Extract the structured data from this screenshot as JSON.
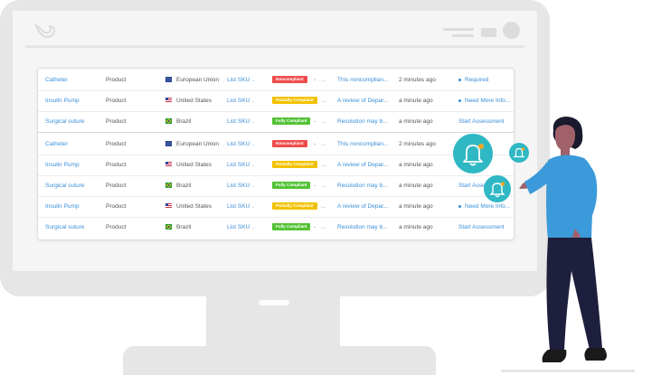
{
  "colors": {
    "link": "#3a8fd8",
    "noncompliant": "#ef4b4b",
    "partially_compliant": "#f2c200",
    "fully_compliant": "#52c234",
    "bell_accent": "#2fb8c4",
    "notification_dot": "#f5a623"
  },
  "icons": {
    "logo": "bird-logo-icon",
    "bell": "bell-icon",
    "flag_eu": "eu-flag-icon",
    "flag_us": "us-flag-icon",
    "flag_br": "brazil-flag-icon",
    "chevron": "chevron-down-icon"
  },
  "rows": [
    {
      "name": "Catheter",
      "type": "Product",
      "flag": "eu",
      "country": "European Union",
      "sku": "List SKU",
      "badge": "Noncompliant",
      "badge_kind": "noncompliant",
      "dots": "...",
      "review": "This noncomplian...",
      "time": "2 minutes ago",
      "status": "Required",
      "status_dot": true
    },
    {
      "name": "Insulin Pump",
      "type": "Product",
      "flag": "us",
      "country": "United States",
      "sku": "List SKU",
      "badge": "Partially Compliant",
      "badge_kind": "partially_compliant",
      "dots": "...",
      "review": "A review of Depar...",
      "time": "a minute ago",
      "status": "Need More Info...",
      "status_dot": true
    },
    {
      "name": "Surgical suture",
      "type": "Product",
      "flag": "br",
      "country": "Brazil",
      "sku": "List SKU",
      "badge": "Fully Compliant",
      "badge_kind": "fully_compliant",
      "dots": "...",
      "review": "Resolution may b...",
      "time": "a minute ago",
      "status": "Start Assessment",
      "status_dot": false
    },
    {
      "name": "Catheter",
      "type": "Product",
      "flag": "eu",
      "country": "European Union",
      "sku": "List SKU",
      "badge": "Noncompliant",
      "badge_kind": "noncompliant",
      "dots": "...",
      "review": "This noncomplian...",
      "time": "2 minutes ago",
      "status": "",
      "status_dot": false
    },
    {
      "name": "Insulin Pump",
      "type": "Product",
      "flag": "us",
      "country": "United States",
      "sku": "List SKU",
      "badge": "Partially Compliant",
      "badge_kind": "partially_compliant",
      "dots": "...",
      "review": "A review of Depar...",
      "time": "a minute ago",
      "status": "Info...",
      "status_dot": false
    },
    {
      "name": "Surgical suture",
      "type": "Product",
      "flag": "br",
      "country": "Brazil",
      "sku": "List SKU",
      "badge": "Fully Compliant",
      "badge_kind": "fully_compliant",
      "dots": "...",
      "review": "Resolution may b...",
      "time": "a minute ago",
      "status": "Start Assessment",
      "status_dot": false
    },
    {
      "name": "Insulin Pump",
      "type": "Product",
      "flag": "us",
      "country": "United States",
      "sku": "List SKU",
      "badge": "Partially Compliant",
      "badge_kind": "partially_compliant",
      "dots": "...",
      "review": "A review of Depar...",
      "time": "a minute ago",
      "status": "Need More Info...",
      "status_dot": true
    },
    {
      "name": "Surgical suture",
      "type": "Product",
      "flag": "br",
      "country": "Brazil",
      "sku": "List SKU",
      "badge": "Fully Compliant",
      "badge_kind": "fully_compliant",
      "dots": "...",
      "review": "Resolution may b...",
      "time": "a minute ago",
      "status": "Start Assessment",
      "status_dot": false
    }
  ]
}
